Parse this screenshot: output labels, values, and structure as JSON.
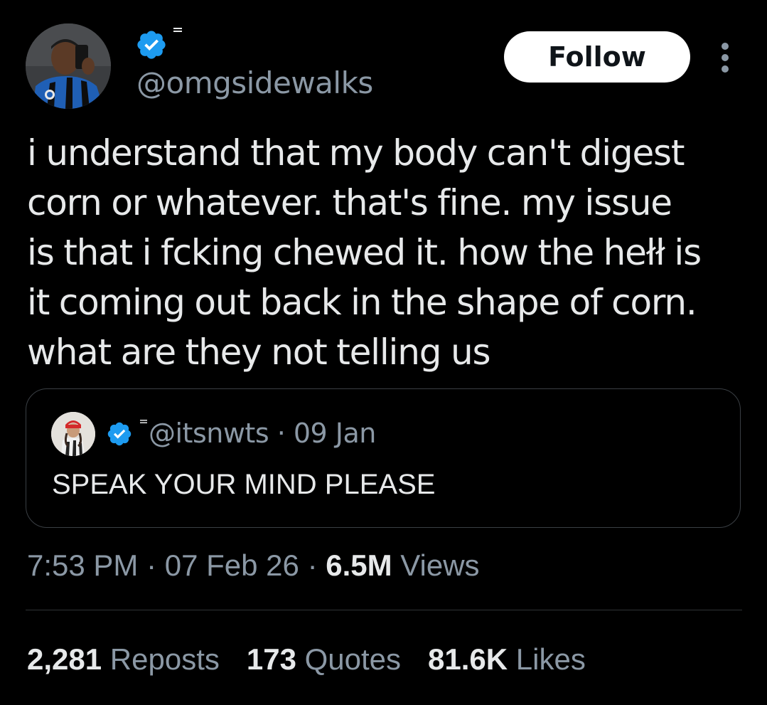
{
  "author": {
    "handle": "@omgsidewalks",
    "avatar_icon": "user-avatar-photo",
    "verified_icon": "verified-badge-icon",
    "verified_color": "#1d9bf0",
    "affiliation_icon": "flag-icon"
  },
  "follow_button": {
    "label": "Follow"
  },
  "more_icon": "more-vertical-icon",
  "tweet": {
    "lines": [
      "i understand that my body can't digest",
      "corn or whatever. that's fine. my issue",
      "is that i fcking chewed it. how the hełł is",
      "it coming out back in the shape of corn.",
      "what are they not telling us"
    ]
  },
  "quote": {
    "handle": "@itsnwts",
    "separator": " · ",
    "date": "09 Jan",
    "text": "SPEAK YOUR MIND PLEASE",
    "verified_icon": "verified-badge-icon"
  },
  "meta": {
    "time": "7:53 PM",
    "separator": " · ",
    "date": "07 Feb 26",
    "views_count": "6.5M",
    "views_label": "Views"
  },
  "stats": {
    "reposts_count": "2,281",
    "reposts_label": "Reposts",
    "quotes_count": "173",
    "quotes_label": "Quotes",
    "likes_count": "81.6K",
    "likes_label": "Likes"
  },
  "colors": {
    "background": "#000000",
    "text_primary": "#e7e9ea",
    "text_secondary": "#8b98a5",
    "accent": "#1d9bf0",
    "border": "#2f3336"
  }
}
